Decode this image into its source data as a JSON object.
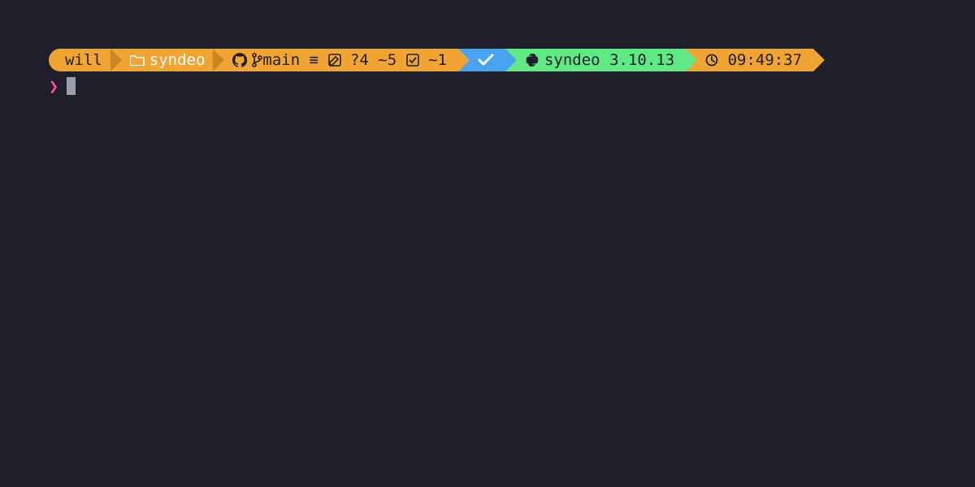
{
  "prompt": {
    "user": "will",
    "cwd": "syndeo",
    "git": {
      "branch": "main",
      "untracked": "?4",
      "behind": "~5",
      "staged": "~1"
    },
    "status_ok": "✓",
    "python": {
      "env": "syndeo",
      "version": "3.10.13"
    },
    "time": "09:49:37",
    "symbol": "❯"
  }
}
